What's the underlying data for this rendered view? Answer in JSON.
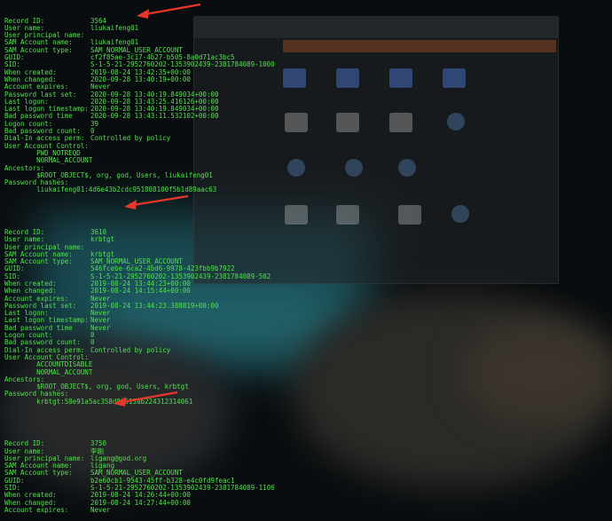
{
  "terminal": {
    "records": [
      {
        "lines": [
          {
            "k": "Record ID:",
            "v": "3564"
          },
          {
            "k": "User name:",
            "v": "liukaifeng01"
          },
          {
            "k": "User principal name:",
            "v": ""
          },
          {
            "k": "SAM Account name:",
            "v": "liukaifeng01"
          },
          {
            "k": "SAM Account type:",
            "v": "SAM_NORMAL_USER_ACCOUNT"
          },
          {
            "k": "GUID:",
            "v": "cf2f85ae-3c17-4b27-b505-8a0d71ac3bc5"
          },
          {
            "k": "SID:",
            "v": "S-1-5-21-2952760202-1353902439-2381784089-1000"
          },
          {
            "k": "When created:",
            "v": "2019-08-24 13:42:35+00:00"
          },
          {
            "k": "When changed:",
            "v": "2020-09-28 13:40:19+00:00"
          },
          {
            "k": "Account expires:",
            "v": "Never"
          },
          {
            "k": "Password last set:",
            "v": "2020-09-28 13:40:19.849034+00:00"
          },
          {
            "k": "Last logon:",
            "v": "2020-09-28 13:43:25.416126+00:00"
          },
          {
            "k": "Last logon timestamp:",
            "v": "2020-09-28 13:40:19.849034+00:00"
          },
          {
            "k": "Bad password time",
            "v": "2020-09-28 13:43:11.532102+00:00"
          },
          {
            "k": "Logon count:",
            "v": "39"
          },
          {
            "k": "Bad password count:",
            "v": "0"
          },
          {
            "k": "Dial-In access perm:",
            "v": "Controlled by policy"
          },
          {
            "k": "User Account Control:",
            "v": ""
          },
          {
            "k": "",
            "v": "        PWD_NOTREQD"
          },
          {
            "k": "",
            "v": "        NORMAL_ACCOUNT"
          },
          {
            "k": "Ancestors:",
            "v": ""
          },
          {
            "k": "",
            "v": "        $ROOT_OBJECT$, org, god, Users, liukaifeng01"
          },
          {
            "k": "Password hashes:",
            "v": ""
          },
          {
            "k": "",
            "v": "        liukaifeng01:4d6e43b2cdc951808100f5b1d89aac63"
          }
        ]
      },
      {
        "lines": [
          {
            "k": "Record ID:",
            "v": "3610"
          },
          {
            "k": "User name:",
            "v": "krbtgt"
          },
          {
            "k": "User principal name:",
            "v": ""
          },
          {
            "k": "SAM Account name:",
            "v": "krbtgt"
          },
          {
            "k": "SAM Account type:",
            "v": "SAM_NORMAL_USER_ACCOUNT"
          },
          {
            "k": "GUID:",
            "v": "546fcebe-6ca2-4bd6-9978-423fbb9b7922"
          },
          {
            "k": "SID:",
            "v": "S-1-5-21-2952760202-1353902439-2381784089-502"
          },
          {
            "k": "When created:",
            "v": "2019-08-24 13:44:23+00:00"
          },
          {
            "k": "When changed:",
            "v": "2019-08-24 14:15:44+00:00"
          },
          {
            "k": "Account expires:",
            "v": "Never"
          },
          {
            "k": "Password last set:",
            "v": "2019-08-24 13:44:23.388819+00:00"
          },
          {
            "k": "Last logon:",
            "v": "Never"
          },
          {
            "k": "Last logon timestamp:",
            "v": "Never"
          },
          {
            "k": "Bad password time",
            "v": "Never"
          },
          {
            "k": "Logon count:",
            "v": "0"
          },
          {
            "k": "Bad password count:",
            "v": "0"
          },
          {
            "k": "Dial-In access perm:",
            "v": "Controlled by policy"
          },
          {
            "k": "User Account Control:",
            "v": ""
          },
          {
            "k": "",
            "v": "        ACCOUNTDISABLE"
          },
          {
            "k": "",
            "v": "        NORMAL_ACCOUNT"
          },
          {
            "k": "Ancestors:",
            "v": ""
          },
          {
            "k": "",
            "v": "        $ROOT_OBJECT$, org, god, Users, krbtgt"
          },
          {
            "k": "Password hashes:",
            "v": ""
          },
          {
            "k": "",
            "v": "        krbtgt:58e91a5ac358d86513ab224312314061"
          }
        ]
      },
      {
        "lines": [
          {
            "k": "Record ID:",
            "v": "3750"
          },
          {
            "k": "User name:",
            "v": "李刚"
          },
          {
            "k": "User principal name:",
            "v": "ligang@god.org"
          },
          {
            "k": "SAM Account name:",
            "v": "ligang"
          },
          {
            "k": "SAM Account type:",
            "v": "SAM_NORMAL_USER_ACCOUNT"
          },
          {
            "k": "GUID:",
            "v": "b2e60cb1-9543-45ff-b328-e4c0fd9feac1"
          },
          {
            "k": "SID:",
            "v": "S-1-5-21-2952760202-1353902439-2381784089-1106"
          },
          {
            "k": "When created:",
            "v": "2019-08-24 14:26:44+00:00"
          },
          {
            "k": "When changed:",
            "v": "2019-08-24 14:27:44+00:00"
          },
          {
            "k": "Account expires:",
            "v": "Never"
          }
        ]
      }
    ]
  },
  "colors": {
    "text": "#4fe24a",
    "arrow": "#e8372a",
    "background": "#0a0d0f"
  }
}
